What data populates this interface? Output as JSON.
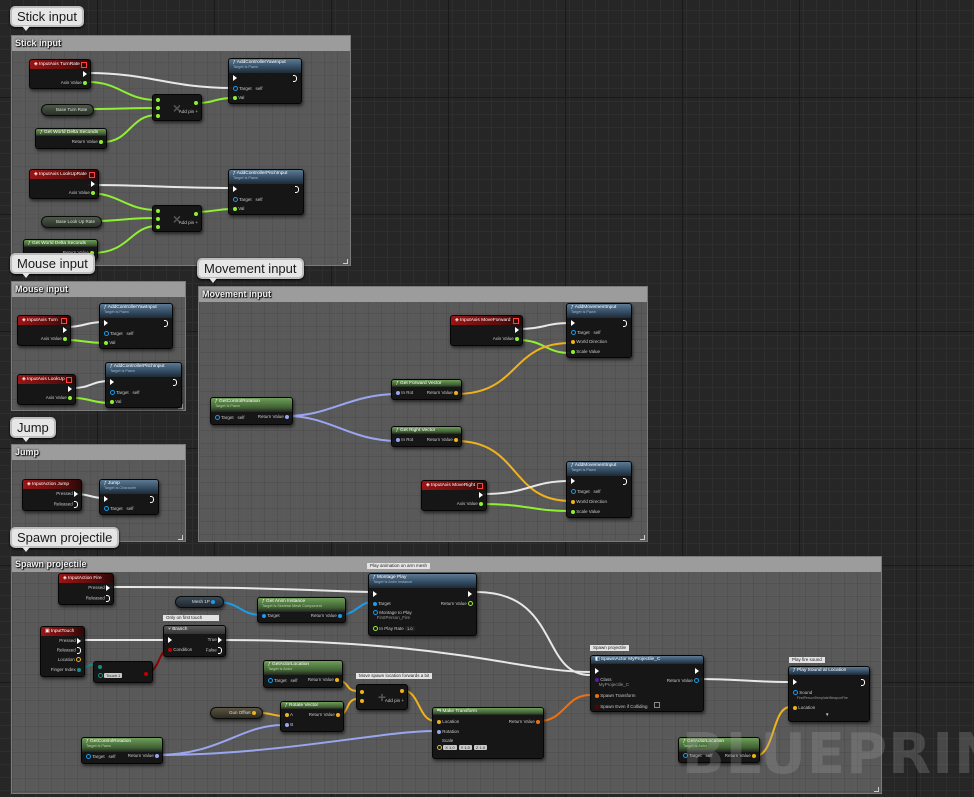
{
  "watermark": "BLUEPRINT",
  "bubbles": {
    "stick": "Stick input",
    "mouse": "Mouse input",
    "movement": "Movement input",
    "jump": "Jump",
    "spawn": "Spawn projectile"
  },
  "comments": {
    "stick": "Stick input",
    "mouse": "Mouse input",
    "movement": "Movement input",
    "jump": "Jump",
    "spawn": "Spawn projectile"
  },
  "labels": {
    "axis_value": "Axis Value",
    "target": "Target",
    "self": "self",
    "val": "Val",
    "return_value": "Return Value",
    "add_pin": "Add pin",
    "target_is_pawn": "Target is Pawn",
    "target_is_character": "Target is Character",
    "target_is_actor": "Target is Actor",
    "pressed": "Pressed",
    "released": "Released",
    "in_rot": "In Rot",
    "world_direction": "World Direction",
    "scale_value": "Scale Value",
    "location": "Location",
    "finger_index": "Finger Index",
    "condition": "Condition",
    "true": "True",
    "false": "False",
    "rotation": "Rotation",
    "scale": "Scale",
    "a": "A",
    "b": "B",
    "class": "Class",
    "spawn_transform": "Spawn Transform",
    "spawn_even_if_colliding": "Spawn Even if Colliding",
    "sound": "Sound",
    "montage_to_play": "Montage to Play",
    "in_play_rate": "In Play Rate"
  },
  "stick": {
    "turn_event": "InputAxis TurnRate",
    "yaw_fn": "AddControllerYawInput",
    "base_turn_rate": "Base Turn Rate",
    "delta1": "Get World Delta Seconds",
    "lookup_event": "InputAxis LookUpRate",
    "pitch_fn": "AddControllerPitchInput",
    "base_lookup_rate": "Base Look Up Rate",
    "delta2": "Get World Delta Seconds"
  },
  "mouse": {
    "turn_event": "InputAxis Turn",
    "yaw_fn": "AddControllerYawInput",
    "lookup_event": "InputAxis LookUp",
    "pitch_fn": "AddControllerPitchInput"
  },
  "jump": {
    "event": "InputAction Jump",
    "fn": "Jump"
  },
  "movement": {
    "control_rot": "GetControlRotation",
    "forward_vec": "Get Forward Vector",
    "right_vec": "Get Right Vector",
    "fwd_event": "InputAxis MoveForward",
    "right_event": "InputAxis MoveRight",
    "add_move1": "AddMovementInput",
    "add_move2": "AddMovementInput"
  },
  "spawn": {
    "fire_event": "InputAction Fire",
    "touch_event": "InputTouch",
    "mesh_var": "Mesh 1P",
    "anim_fn": "Get Anim Instance",
    "anim_sub": "Target is Skeletal Mesh Component",
    "montage_fn": "Montage Play",
    "montage_sub": "Target is Anim Instance",
    "montage_value": "FirstPerson_Fire",
    "play_rate": "1.0",
    "note_montage": "Play animation on arm mesh",
    "note_branch": "Only on first touch",
    "branch": "Branch",
    "touch_select": "Touch 1",
    "actor_loc": "GetActorLocation",
    "note_add": "Move spawn location forwards a bit",
    "gun_offset": "Gun Offset",
    "rotate_vec": "Rotate Vector",
    "make_transform": "Make Transform",
    "scale_x": "X 1.0",
    "scale_y": "Y 1.0",
    "scale_z": "Z 1.0",
    "control_rot": "GetControlRotation",
    "note_spawn": "Spawn projectile",
    "spawn_fn": "SpawnActor MyProjectile_C",
    "class_value": "MyProjectile_C",
    "note_sound": "Play fire sound",
    "sound_fn": "Play Sound at Location",
    "sound_value": "FirstPersonTemplateWeaponFire",
    "actor_loc2": "GetActorLocation"
  },
  "colors": {
    "exec": "#ffffff",
    "float": "#8ff032",
    "vector": "#f0b21c",
    "rotator": "#9aa6f0",
    "object": "#1c9cea",
    "bool": "#920101",
    "transform": "#f07010",
    "struct": "#1a8a8a"
  }
}
